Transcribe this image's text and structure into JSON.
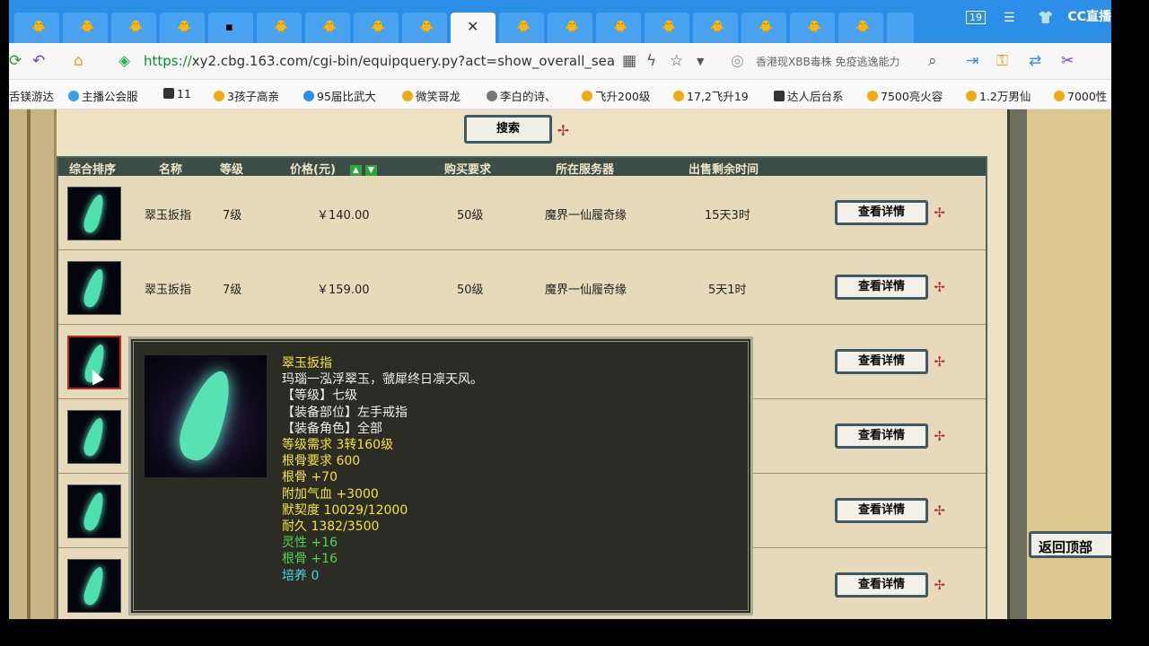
{
  "browser": {
    "active_tab_close": "✕",
    "window_badge": "19",
    "streamer_logo": "CC直播",
    "url_proto": "https://",
    "url_rest": "xy2.cbg.163.com/cgi-bin/equipquery.py?act=show_overall_sea",
    "news_text": "香港现XBB毒株 免疫逃逸能力",
    "bookmarks": [
      {
        "label": "舌镁游达"
      },
      {
        "label": "主播公会服"
      },
      {
        "label": "11"
      },
      {
        "label": "3孩子高亲"
      },
      {
        "label": "95届比武大"
      },
      {
        "label": "微笑哥龙"
      },
      {
        "label": "李白的诗、"
      },
      {
        "label": "飞升200级"
      },
      {
        "label": "17,2飞升19"
      },
      {
        "label": "达人后台系"
      },
      {
        "label": "7500亮火容"
      },
      {
        "label": "1.2万男仙"
      },
      {
        "label": "7000性"
      }
    ]
  },
  "page": {
    "search_label": "搜索",
    "back_top_label": "返回顶部",
    "columns": [
      "综合排序",
      "名称",
      "等级",
      "价格(元)",
      "购买要求",
      "所在服务器",
      "出售剩余时间"
    ],
    "sort_up": "▲",
    "sort_down": "▼",
    "detail_label": "查看详情",
    "rows": [
      {
        "name": "翠玉扳指",
        "level": "7级",
        "price": "￥140.00",
        "requirement": "50级",
        "server": "魔界一仙履奇缘",
        "time_left": "15天3时"
      },
      {
        "name": "翠玉扳指",
        "level": "7级",
        "price": "￥159.00",
        "requirement": "50级",
        "server": "魔界一仙履奇缘",
        "time_left": "5天1时"
      },
      {
        "name": "",
        "level": "",
        "price": "",
        "requirement": "",
        "server": "",
        "time_left": ""
      },
      {
        "name": "",
        "level": "",
        "price": "",
        "requirement": "",
        "server": "",
        "time_left": ""
      },
      {
        "name": "",
        "level": "",
        "price": "",
        "requirement": "",
        "server": "",
        "time_left": ""
      },
      {
        "name": "",
        "level": "",
        "price": "",
        "requirement": "",
        "server": "",
        "time_left": ""
      }
    ],
    "tooltip": {
      "title": "翠玉扳指",
      "desc": "玛瑙一泓浮翠玉，虢犀终日凛天风。",
      "lines": [
        {
          "text": "【等级】七级",
          "color": "white"
        },
        {
          "text": "【装备部位】左手戒指",
          "color": "white"
        },
        {
          "text": "【装备角色】全部",
          "color": "white"
        },
        {
          "text": "等级需求 3转160级",
          "color": "yellow"
        },
        {
          "text": "根骨要求 600",
          "color": "yellow"
        },
        {
          "text": "根骨 +70",
          "color": "yellow"
        },
        {
          "text": "附加气血 +3000",
          "color": "yellow"
        },
        {
          "text": "默契度 10029/12000",
          "color": "yellow"
        },
        {
          "text": "耐久 1382/3500",
          "color": "yellow"
        },
        {
          "text": "灵性 +16",
          "color": "green"
        },
        {
          "text": "根骨 +16",
          "color": "green"
        },
        {
          "text": "培养 0",
          "color": "cyan"
        }
      ]
    }
  }
}
